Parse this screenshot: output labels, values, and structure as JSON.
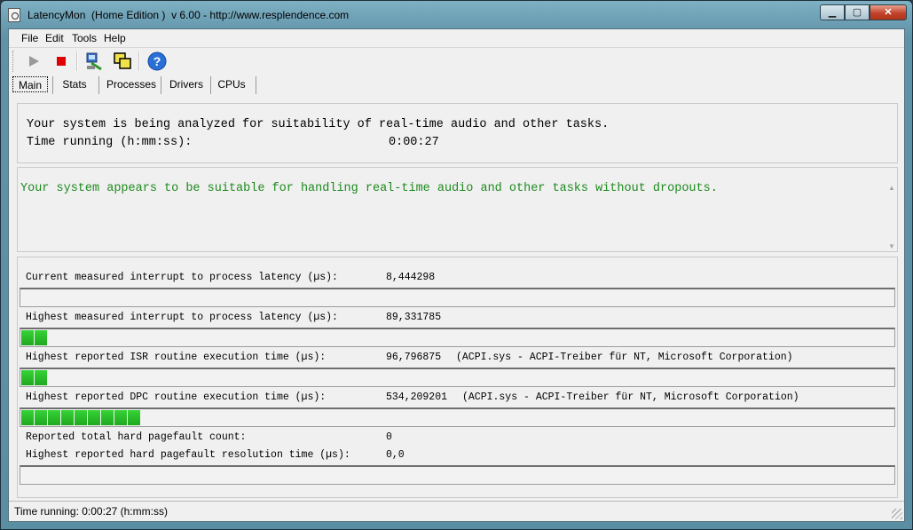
{
  "window": {
    "title": "LatencyMon  (Home Edition )  v 6.00 - http://www.resplendence.com"
  },
  "menu": [
    "File",
    "Edit",
    "Tools",
    "Help"
  ],
  "toolbar": {
    "icons": [
      "play-icon",
      "stop-icon",
      "system-tool-icon",
      "window-stack-icon",
      "help-icon"
    ]
  },
  "tabs": [
    "Main",
    "Stats",
    "Processes",
    "Drivers",
    "CPUs"
  ],
  "analysis": {
    "line1": "Your system is being analyzed for suitability of real-time audio and other tasks.",
    "time_label": "Time running (h:mm:ss):",
    "time_value": "0:00:27"
  },
  "conclusion": {
    "text": "Your system appears to be suitable for handling real-time audio and other tasks without dropouts.",
    "color": "#1e8a1e"
  },
  "metrics": [
    {
      "label": "Current measured interrupt to process latency (µs):",
      "value": "8,444298",
      "extra": "",
      "fill": 0
    },
    {
      "label": "Highest measured interrupt to process latency (µs):",
      "value": "89,331785",
      "extra": "",
      "fill": 0.03
    },
    {
      "label": "Highest reported ISR routine execution time (µs):",
      "value": "96,796875",
      "extra": "(ACPI.sys - ACPI-Treiber für NT, Microsoft Corporation)",
      "fill": 0.03
    },
    {
      "label": "Highest reported DPC routine execution time (µs):",
      "value": "534,209201",
      "extra": "(ACPI.sys - ACPI-Treiber für NT, Microsoft Corporation)",
      "fill": 0.14
    },
    {
      "label": "Reported total hard pagefault count:",
      "value": "0",
      "extra": "",
      "fill": null
    },
    {
      "label": "Highest reported hard pagefault resolution time (µs):",
      "value": "0,0",
      "extra": "",
      "fill": 0
    }
  ],
  "status": {
    "text": "Time running: 0:00:27  (h:mm:ss)"
  }
}
